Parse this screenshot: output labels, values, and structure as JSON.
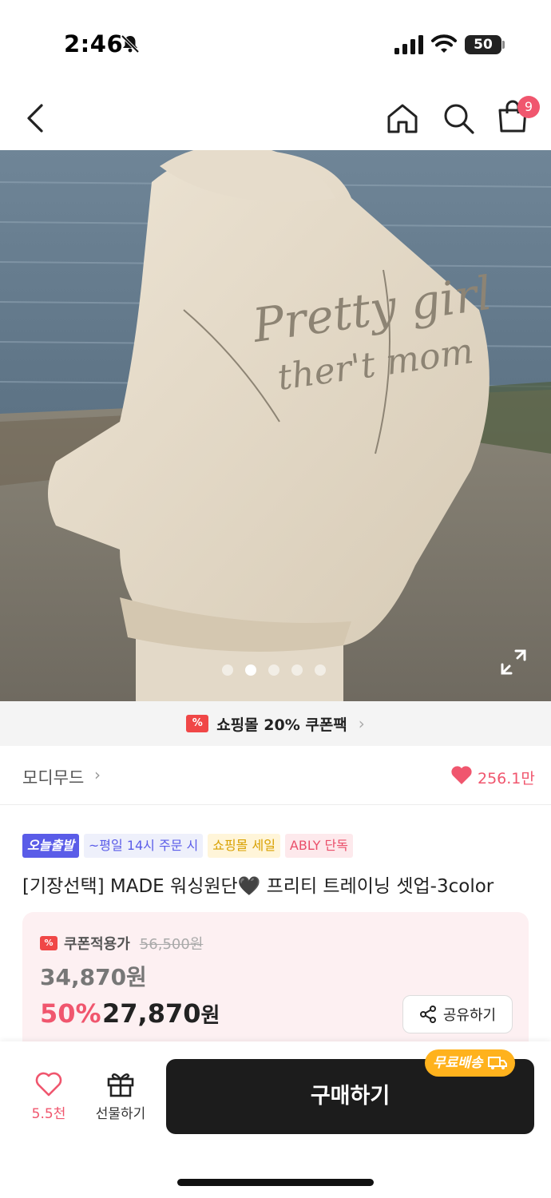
{
  "status_bar": {
    "time": "2:46",
    "battery": "50"
  },
  "nav": {
    "cart_badge": "9"
  },
  "hero": {
    "photo_text": "Pretty girl",
    "dots_total": 5,
    "active_dot": 1
  },
  "coupon_pack": {
    "icon_text": "%",
    "label": "쇼핑몰 20% 쿠폰팩"
  },
  "shop": {
    "name": "모디무드",
    "likes": "256.1만"
  },
  "tags": [
    "오늘출발",
    "~평일 14시 주문 시",
    "쇼핑몰 세일",
    "ABLY 단독"
  ],
  "product": {
    "title": "[기장선택] MADE 워싱원단🖤 프리티 트레이닝 셋업-3color"
  },
  "price": {
    "coupon_label": "쿠폰적용가",
    "original": "56,500원",
    "mid": "34,870원",
    "discount": "50%",
    "final": "27,870",
    "won": "원",
    "share_label": "공유하기"
  },
  "bottom": {
    "wish_count": "5.5천",
    "gift_label": "선물하기",
    "buy_label": "구매하기",
    "free_ship_label": "무료배송"
  },
  "colors": {
    "accent": "#f0566e",
    "buy_button": "#1c1c1c",
    "free_ship": "#ffb21d",
    "tag_today": "#5a5ce8"
  }
}
